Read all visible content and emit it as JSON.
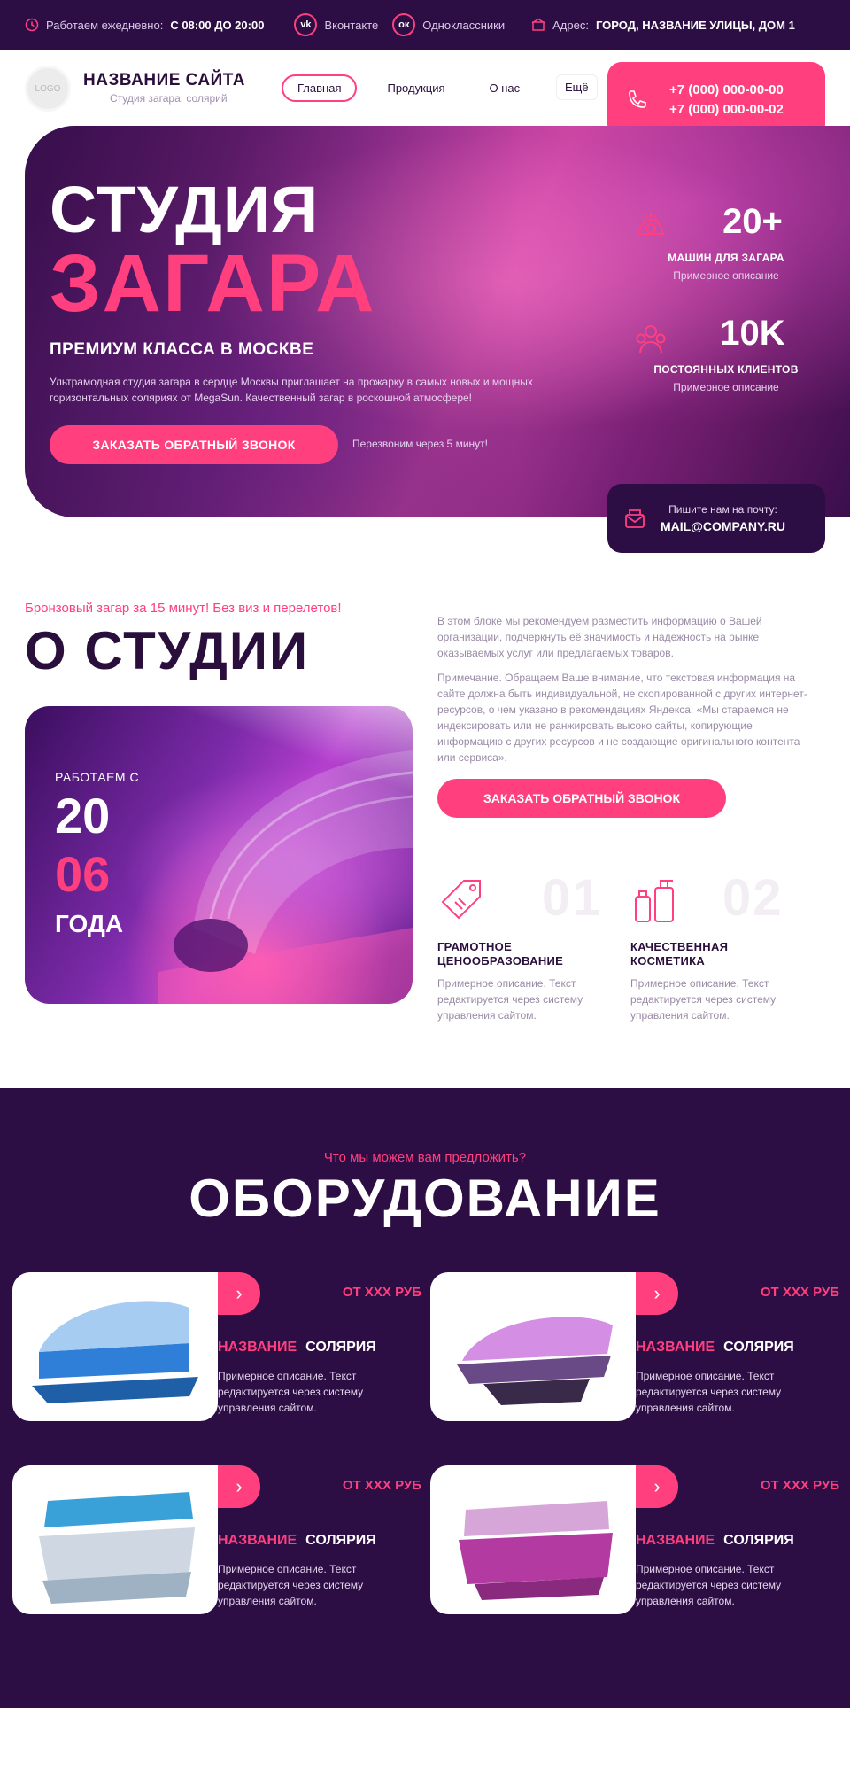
{
  "topbar": {
    "hours_label": "Работаем ежедневно:",
    "hours_value": "С 08:00 ДО 20:00",
    "vk": "Вконтакте",
    "ok": "Одноклассники",
    "address_label": "Адрес:",
    "address_value": "ГОРОД, НАЗВАНИЕ УЛИЦЫ, ДОМ 1"
  },
  "header": {
    "logo": "LOGO",
    "site_name": "НАЗВАНИЕ САЙТА",
    "tagline": "Студия загара, солярий",
    "nav": [
      "Главная",
      "Продукция",
      "О нас"
    ],
    "more": "Ещё",
    "phone1": "+7 (000) 000-00-00",
    "phone2": "+7 (000) 000-00-02"
  },
  "hero": {
    "title_line1": "СТУДИЯ",
    "title_line2": "ЗАГАРА",
    "subtitle": "ПРЕМИУМ КЛАССА В МОСКВЕ",
    "description": "Ультрамодная студия загара в сердце Москвы приглашает на прожарку в самых новых и мощных горизонтальных соляриях от MegaSun. Качественный загар в роскошной атмосфере!",
    "cta": "ЗАКАЗАТЬ ОБРАТНЫЙ ЗВОНОК",
    "cta_note": "Перезвоним через 5 минут!",
    "stats": [
      {
        "num": "20+",
        "caption": "МАШИН ДЛЯ ЗАГАРА",
        "desc": "Примерное описание"
      },
      {
        "num": "10K",
        "caption": "ПОСТОЯННЫХ КЛИЕНТОВ",
        "desc": "Примерное описание"
      }
    ],
    "mail_label": "Пишите нам на почту:",
    "mail_value": "MAIL@COMPANY.RU"
  },
  "about": {
    "kicker": "Бронзовый загар за 15 минут! Без виз и перелетов!",
    "title": "О СТУДИИ",
    "since_label": "РАБОТАЕМ С",
    "since_year1": "20",
    "since_year2": "06",
    "since_suffix": "ГОДА",
    "p1": "В этом блоке мы рекомендуем разместить информацию о Вашей организации, подчеркнуть её значимость и надежность на рынке оказываемых услуг или предлагаемых товаров.",
    "p2": "Примечание. Обращаем Ваше внимание, что текстовая информация на сайте должна быть индивидуальной, не скопированной с других интернет-ресурсов, о чем указано в рекомендациях Яндекса: «Мы стараемся не индексировать или не ранжировать высоко сайты, копирующие информацию с других ресурсов и не создающие оригинального контента или сервиса».",
    "cta": "ЗАКАЗАТЬ ОБРАТНЫЙ ЗВОНОК",
    "features": [
      {
        "num": "01",
        "title": "ГРАМОТНОЕ ЦЕНООБРАЗОВАНИЕ",
        "desc": "Примерное описание. Текст редактируется через систему управления сайтом."
      },
      {
        "num": "02",
        "title": "КАЧЕСТВЕННАЯ КОСМЕТИКА",
        "desc": "Примерное описание. Текст редактируется через систему управления сайтом."
      }
    ]
  },
  "equipment": {
    "kicker": "Что мы можем вам предложить?",
    "title": "ОБОРУДОВАНИЕ",
    "cards": [
      {
        "price": "ОТ ХХХ РУБ",
        "name_a": "НАЗВАНИЕ",
        "name_b": "СОЛЯРИЯ",
        "desc": "Примерное описание. Текст редактируется через систему управления сайтом.",
        "color": "#2f7fd8"
      },
      {
        "price": "ОТ ХХХ РУБ",
        "name_a": "НАЗВАНИЕ",
        "name_b": "СОЛЯРИЯ",
        "desc": "Примерное описание. Текст редактируется через систему управления сайтом.",
        "color": "#6a4a86"
      },
      {
        "price": "ОТ ХХХ РУБ",
        "name_a": "НАЗВАНИЕ",
        "name_b": "СОЛЯРИЯ",
        "desc": "Примерное описание. Текст редактируется через систему управления сайтом.",
        "color": "#3aa0d8"
      },
      {
        "price": "ОТ ХХХ РУБ",
        "name_a": "НАЗВАНИЕ",
        "name_b": "СОЛЯРИЯ",
        "desc": "Примерное описание. Текст редактируется через систему управления сайтом.",
        "color": "#b23aa0"
      }
    ]
  },
  "colors": {
    "accent": "#ff3f7e",
    "dark": "#2c0e44"
  }
}
